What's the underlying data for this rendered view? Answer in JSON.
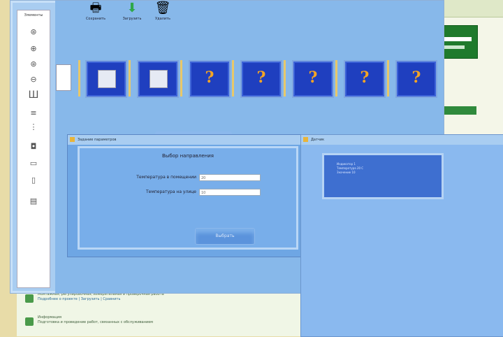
{
  "toolbar": {
    "save_label": "Сохранить",
    "load_label": "Загрузить",
    "delete_label": "Удалить"
  },
  "left_panel": {
    "title": "Элементы"
  },
  "dialog_setup": {
    "title": "Задание параметров",
    "heading": "Выбор направления",
    "indoor_label": "Температура в помещении",
    "indoor_value": "20",
    "outdoor_label": "Температура на улице",
    "outdoor_value": "10",
    "ok_label": "Выбрать"
  },
  "dialog_info": {
    "title": "Датчик",
    "lines": [
      "Индикатор 1",
      "Температура 20 С",
      "Значение 10"
    ]
  },
  "bg_list": {
    "item1_text": "Монтажная, регулировочная, измерительная и проверочная работа",
    "item1_link": "Подробнее о проекте | Загрузить | Сравнить",
    "item2_title": "Информация",
    "item2_text": "Подготовка и проведение работ, связанных с обслуживанием"
  },
  "colors": {
    "window_bg": "#87b8ea",
    "tile_bg": "#1f3fbf",
    "accent_question": "#f5a524",
    "green_brand": "#1f7a2c"
  }
}
